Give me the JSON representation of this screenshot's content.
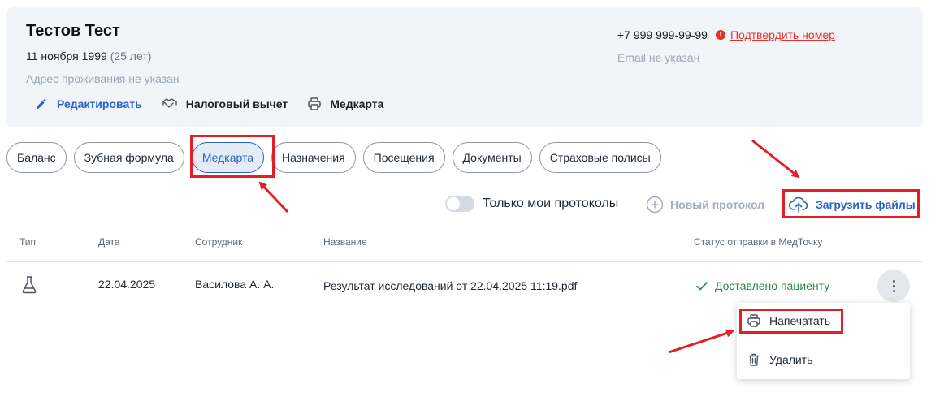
{
  "patient": {
    "name": "Тестов Тест",
    "dob": "11 ноября 1999",
    "age": "(25 лет)",
    "address": "Адрес проживания не указан",
    "phone": "+7 999 999-99-99",
    "confirm_link": "Подтвердить номер",
    "email": "Email не указан",
    "warning_glyph": "!"
  },
  "actions": {
    "edit": "Редактировать",
    "tax": "Налоговый вычет",
    "medcard": "Медкарта"
  },
  "tabs": [
    {
      "label": "Баланс",
      "active": false
    },
    {
      "label": "Зубная формула",
      "active": false
    },
    {
      "label": "Медкарта",
      "active": true
    },
    {
      "label": "Назначения",
      "active": false
    },
    {
      "label": "Посещения",
      "active": false
    },
    {
      "label": "Документы",
      "active": false
    },
    {
      "label": "Страховые полисы",
      "active": false
    }
  ],
  "toolbar": {
    "only_mine_label": "Только мои протоколы",
    "only_mine_checked": false,
    "new_protocol": "Новый протокол",
    "upload": "Загрузить файлы"
  },
  "table": {
    "headers": {
      "type": "Тип",
      "date": "Дата",
      "employee": "Сотрудник",
      "name": "Название",
      "status": "Статус отправки в МедТочку"
    },
    "rows": [
      {
        "type_icon": "flask-icon",
        "date": "22.04.2025",
        "employee": "Василова А. А.",
        "name": "Результат исследований от 22.04.2025 11:19.pdf",
        "status": "Доставлено пациенту"
      }
    ]
  },
  "row_menu": {
    "print": "Напечатать",
    "delete": "Удалить"
  },
  "colors": {
    "accent": "#2b62c9",
    "success": "#2f8a4e",
    "danger": "#e5332a",
    "annotation": "#e41e25"
  }
}
